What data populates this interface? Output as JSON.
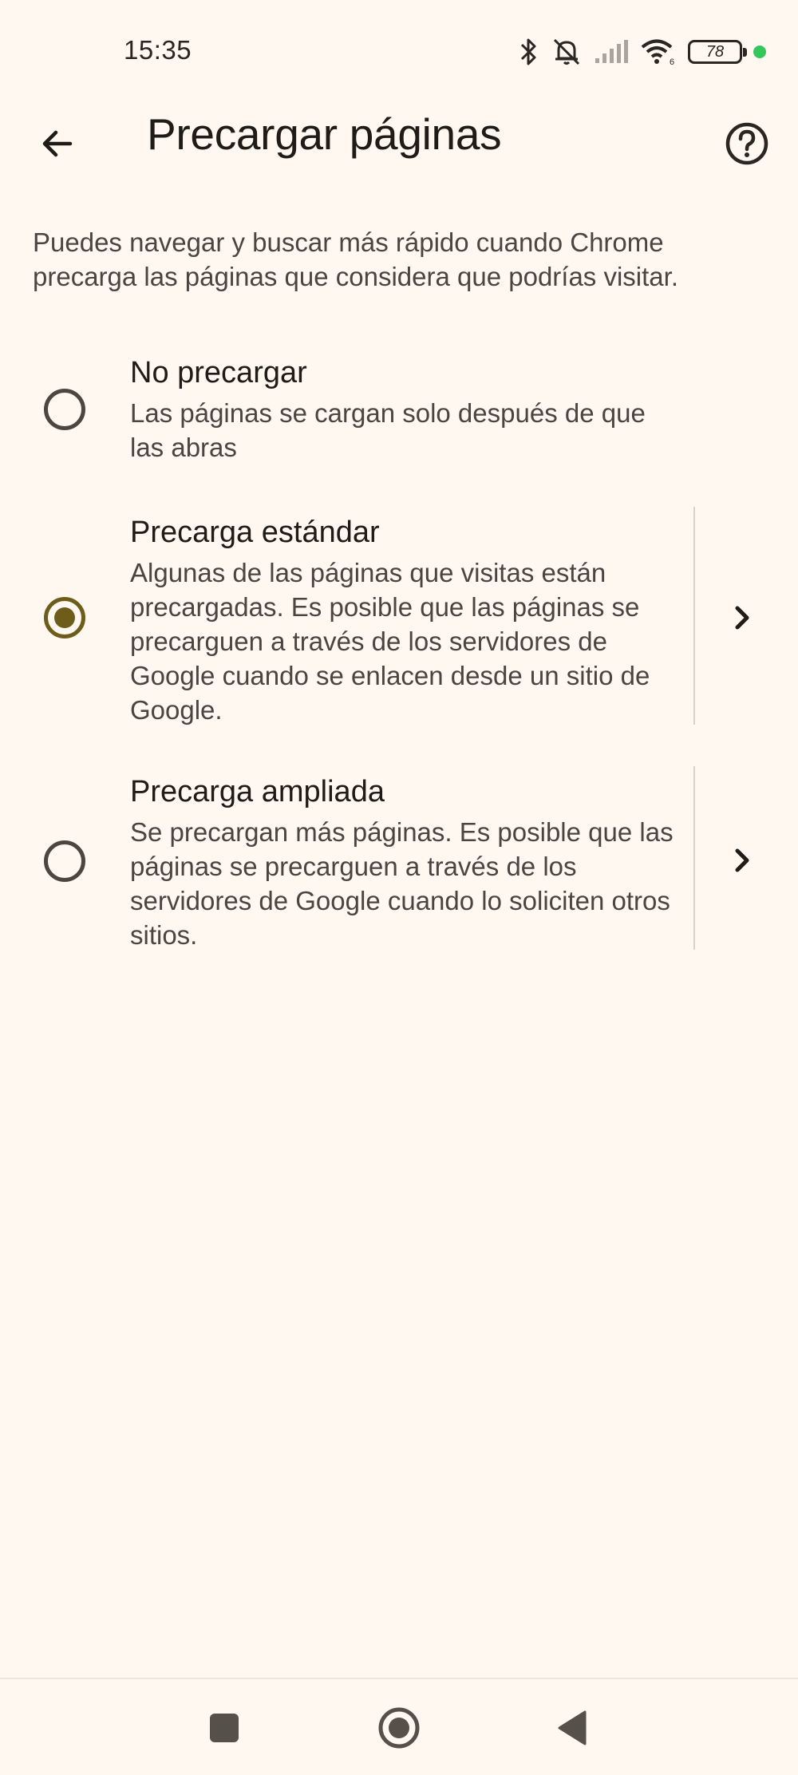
{
  "status_bar": {
    "time": "15:35",
    "battery_level": "78",
    "icons": [
      "bluetooth-icon",
      "silent-bell-icon",
      "signal-icon",
      "wifi-icon",
      "battery-icon",
      "active-dot-icon"
    ]
  },
  "app_bar": {
    "title": "Precargar páginas",
    "back_icon": "arrow-back-icon",
    "help_icon": "help-circle-icon"
  },
  "description": "Puedes navegar y buscar más rápido cuando Chrome precarga las páginas que considera que podrías visitar.",
  "options": [
    {
      "title": "No precargar",
      "description": "Las páginas se cargan solo después de que las abras",
      "selected": false,
      "has_details": false
    },
    {
      "title": "Precarga estándar",
      "description": "Algunas de las páginas que visitas están precargadas. Es posible que las páginas se precarguen a través de los servidores de Google cuando se enlacen desde un sitio de Google.",
      "selected": true,
      "has_details": true
    },
    {
      "title": "Precarga ampliada",
      "description": "Se precargan más páginas. Es posible que las páginas se precarguen a través de los servidores de Google cuando lo soliciten otros sitios.",
      "selected": false,
      "has_details": true
    }
  ],
  "colors": {
    "background": "#fff8f1",
    "accent": "#6e5c1a",
    "text_primary": "#1f1b16",
    "text_secondary": "#4a4540"
  },
  "nav_bar": {
    "icons": [
      "recents-square-icon",
      "home-circle-icon",
      "back-triangle-icon"
    ]
  }
}
